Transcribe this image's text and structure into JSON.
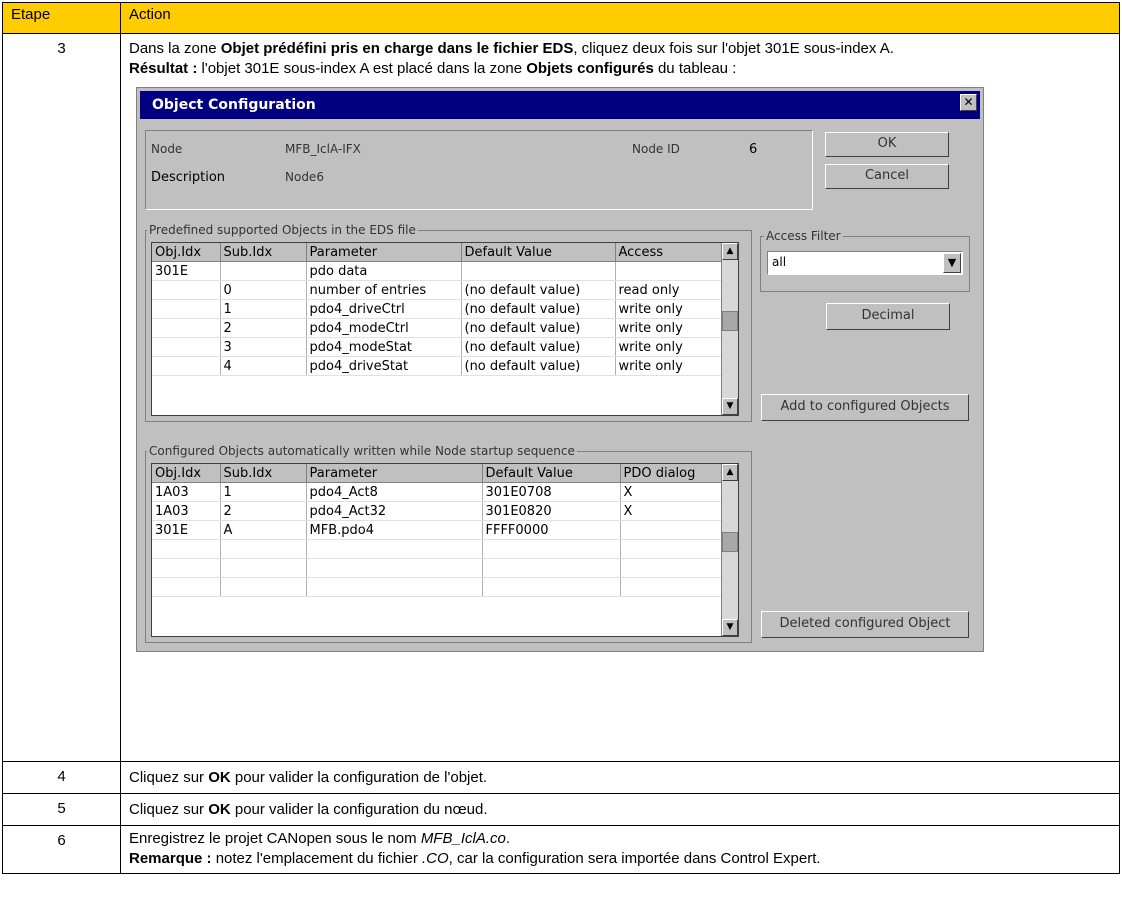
{
  "table": {
    "headers": {
      "step": "Etape",
      "action": "Action"
    },
    "row3": {
      "step": "3",
      "line1": {
        "pre": "Dans la zone ",
        "b": "Objet prédéfini pris en charge dans le fichier EDS",
        "post": ", cliquez deux fois sur l'objet 301E sous-index A."
      },
      "line2": {
        "b1": "Résultat :",
        "mid": " l'objet 301E sous-index A est placé dans la zone ",
        "b2": "Objets configurés",
        "post": " du tableau :"
      }
    },
    "row4": {
      "step": "4",
      "pre": "Cliquez sur ",
      "b": "OK",
      "post": " pour valider la configuration de l'objet."
    },
    "row5": {
      "step": "5",
      "pre": "Cliquez sur ",
      "b": "OK",
      "post": " pour valider la configuration du nœud."
    },
    "row6": {
      "step": "6",
      "line1": {
        "pre": "Enregistrez le projet CANopen sous le nom ",
        "i": "MFB_IclA.co",
        "post": "."
      },
      "line2": {
        "b": "Remarque :",
        "pre": " notez l'emplacement du fichier ",
        "i": ".CO",
        "post": ", car la configuration sera importée dans Control Expert."
      }
    }
  },
  "dialog": {
    "title": "Object Configuration",
    "node_label": "Node",
    "node_value": "MFB_IclA-IFX",
    "node_id_label": "Node ID",
    "node_id_value": "6",
    "description_label": "Description",
    "description_value": "Node6",
    "ok_button": "OK",
    "cancel_button": "Cancel",
    "predefined_group": "Predefined supported Objects in the EDS file",
    "access_filter_group": "Access Filter",
    "access_filter_value": "all",
    "decimal_button": "Decimal",
    "add_button": "Add to configured Objects",
    "configured_group": "Configured Objects automatically written while Node startup sequence",
    "delete_button": "Deleted configured Object",
    "predefined": {
      "columns": [
        "Obj.Idx",
        "Sub.Idx",
        "Parameter",
        "Default Value",
        "Access"
      ],
      "rows": [
        [
          "301E",
          "",
          "pdo data",
          "",
          ""
        ],
        [
          "",
          "0",
          "number of entries",
          "(no default value)",
          "read only"
        ],
        [
          "",
          "1",
          "pdo4_driveCtrl",
          "(no default value)",
          "write only"
        ],
        [
          "",
          "2",
          "pdo4_modeCtrl",
          "(no default value)",
          "write only"
        ],
        [
          "",
          "3",
          "pdo4_modeStat",
          "(no default value)",
          "write only"
        ],
        [
          "",
          "4",
          "pdo4_driveStat",
          "(no default value)",
          "write only"
        ]
      ]
    },
    "configured": {
      "columns": [
        "Obj.Idx",
        "Sub.Idx",
        "Parameter",
        "Default Value",
        "PDO dialog"
      ],
      "rows": [
        [
          "1A03",
          "1",
          "pdo4_Act8",
          "301E0708",
          "X"
        ],
        [
          "1A03",
          "2",
          "pdo4_Act32",
          "301E0820",
          "X"
        ],
        [
          "301E",
          "A",
          "MFB.pdo4",
          "FFFF0000",
          ""
        ],
        [
          "",
          "",
          "",
          "",
          ""
        ],
        [
          "",
          "",
          "",
          "",
          ""
        ],
        [
          "",
          "",
          "",
          "",
          ""
        ]
      ]
    }
  }
}
